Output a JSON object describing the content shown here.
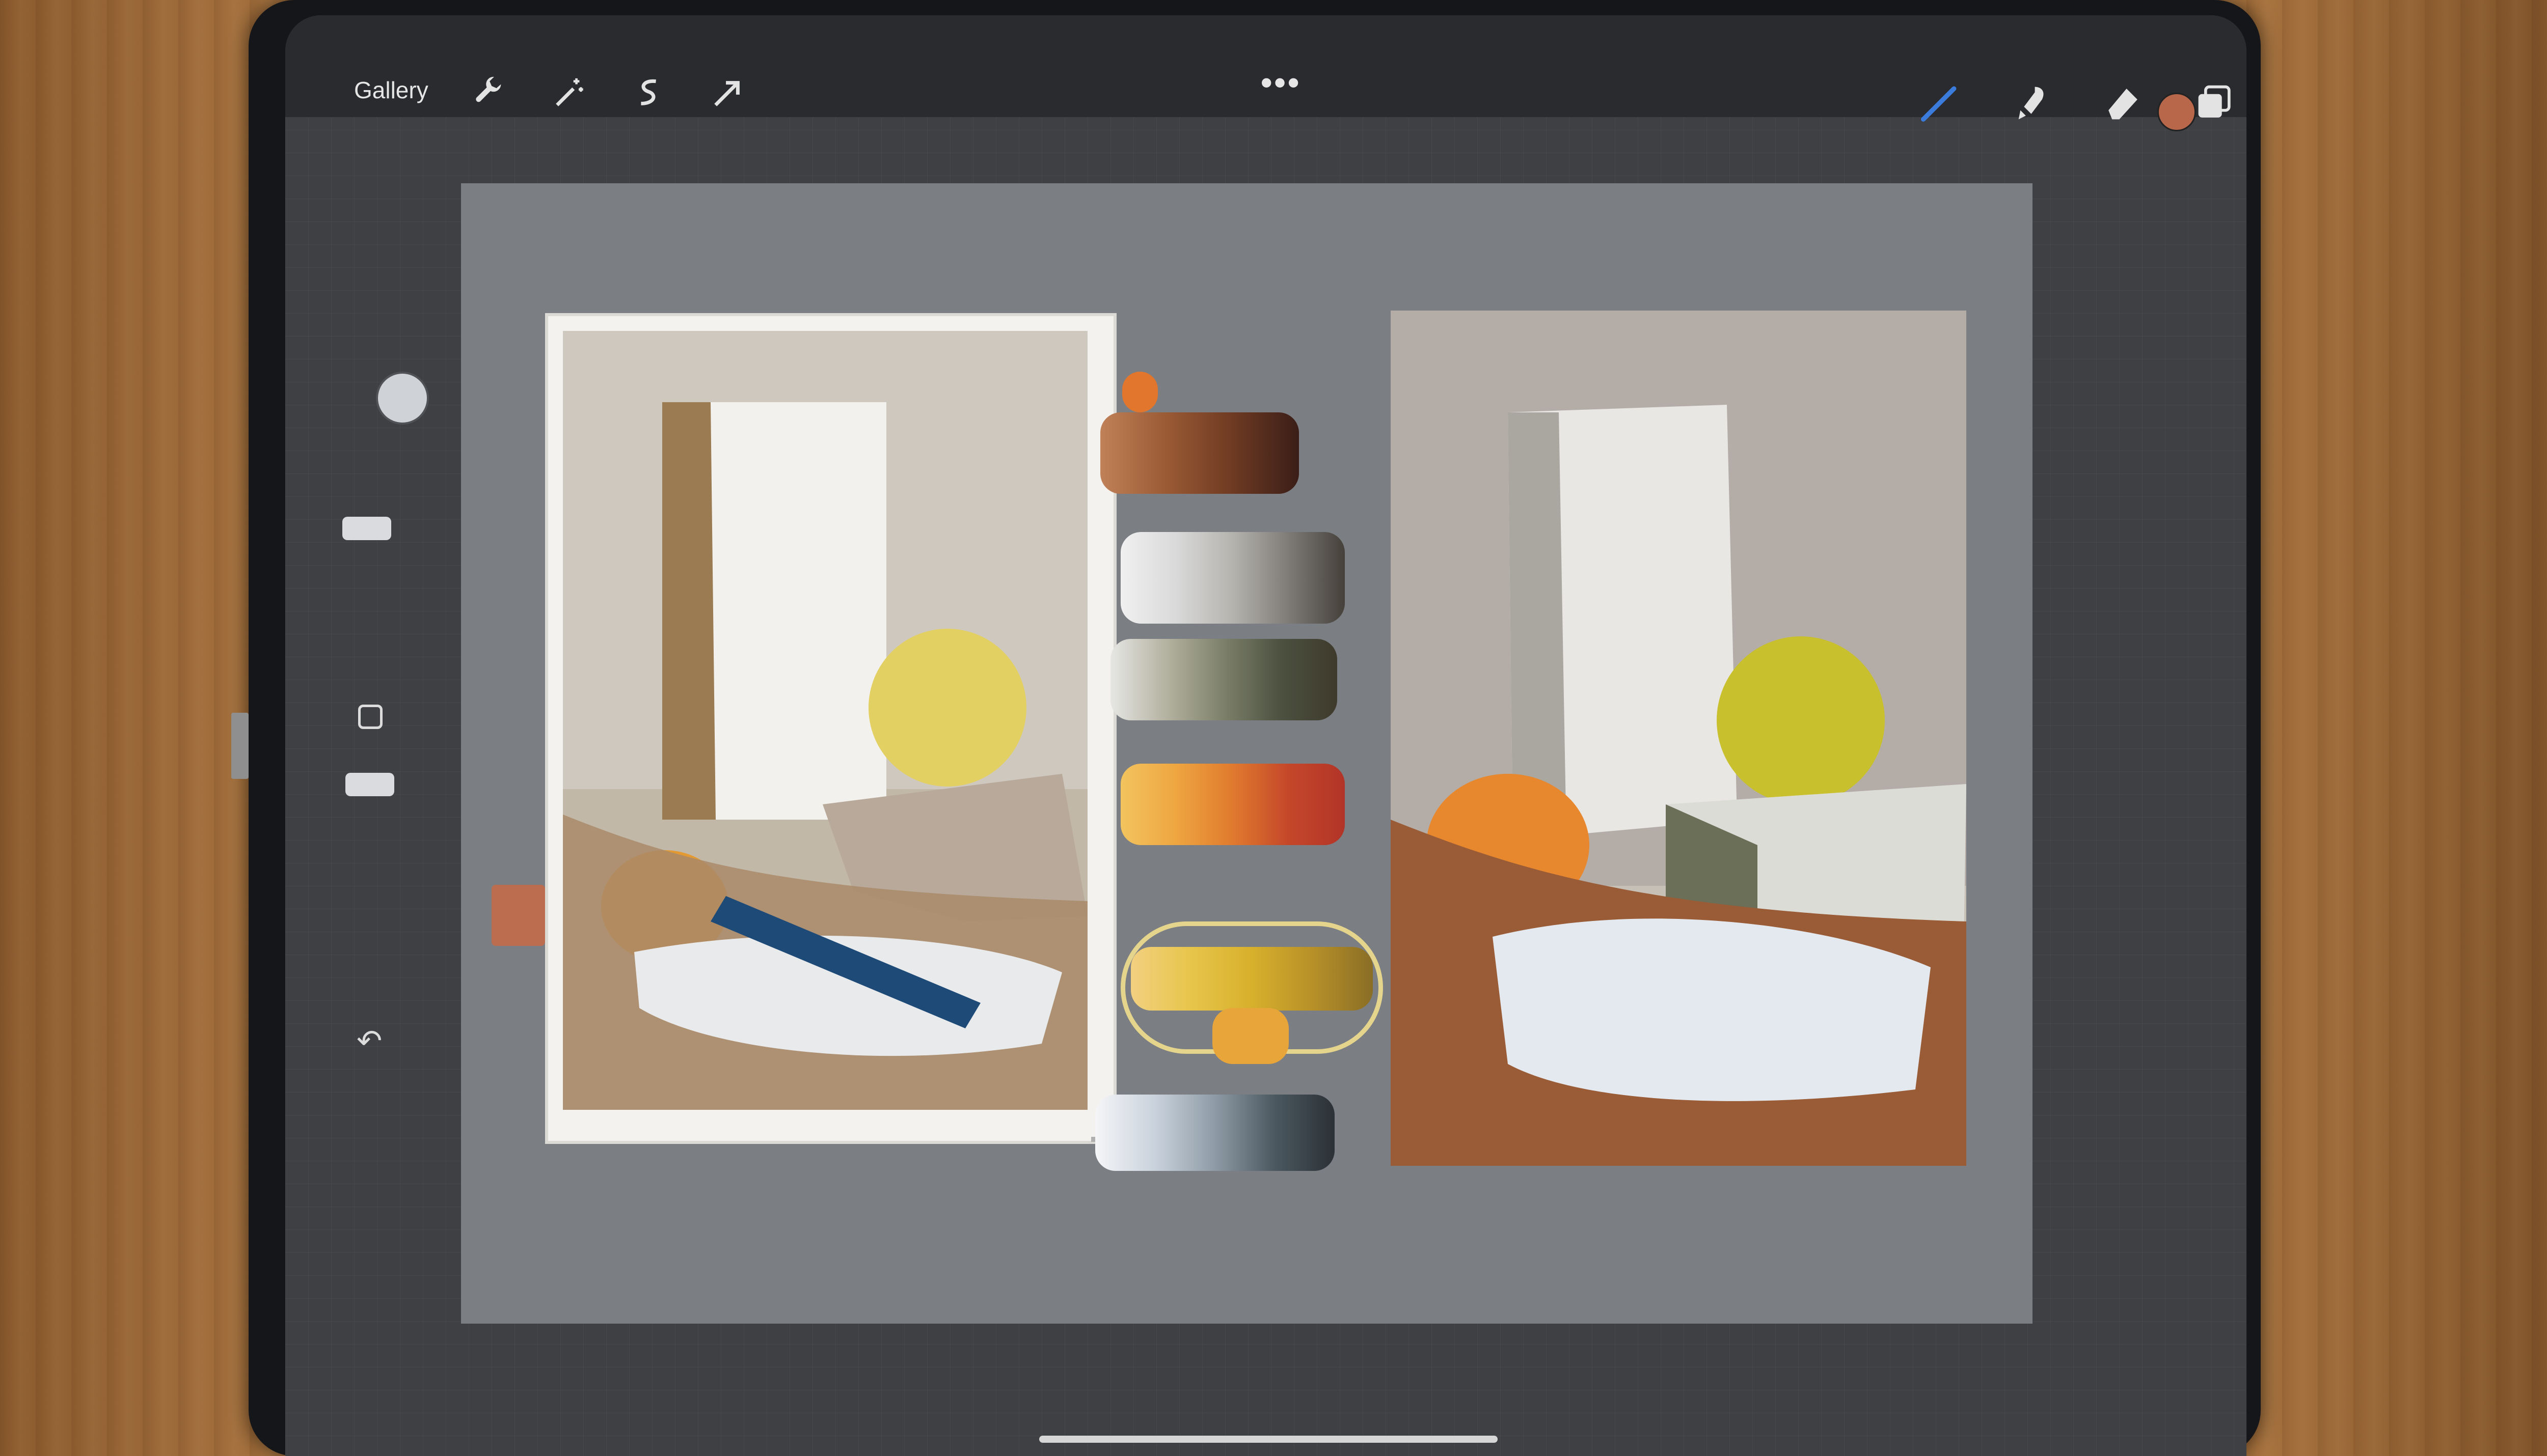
{
  "toolbar": {
    "gallery_label": "Gallery",
    "left_tools": [
      "wrench-icon",
      "magic-wand-icon",
      "selection-icon",
      "transform-arrow-icon"
    ],
    "right_tools": [
      "brush-icon",
      "smudge-icon",
      "eraser-icon",
      "layers-icon"
    ],
    "more_label": "•••",
    "current_color": "#b8674a"
  },
  "sidebar": {
    "undo_symbol": "↶"
  },
  "colors": {
    "accent_brush": "#3b7bdc",
    "canvas_gray": "#7b7e83"
  }
}
